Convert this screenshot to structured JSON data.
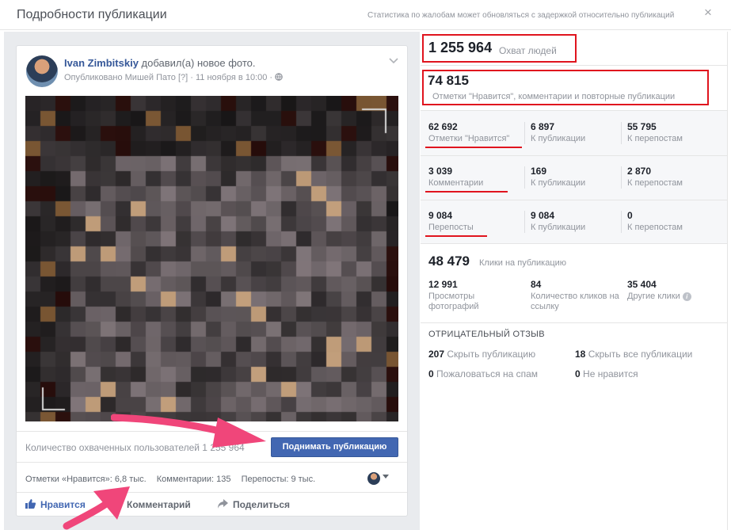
{
  "dialog": {
    "title": "Подробности публикации",
    "note": "Статистика по жалобам может обновляться с задержкой относительно публикаций",
    "close_label": "×"
  },
  "post": {
    "author_name": "Ivan Zimbitskiy",
    "author_action": "добавил(а) новое фото.",
    "published_by": "Опубликовано Мишей Пато",
    "help_marker": "[?]",
    "date": "· 11 ноября в 10:00 ·",
    "reach_text": "Количество охваченных пользователей 1 255 964",
    "boost_button": "Поднимать публикацию",
    "counts": {
      "likes": "Отметки «Нравится»: 6,8 тыс.",
      "comments": "Комментарии: 135",
      "shares": "Перепосты: 9 тыс."
    },
    "actions": {
      "like": "Нравится",
      "comment": "Комментарий",
      "share": "Поделиться"
    }
  },
  "stats": {
    "reach": {
      "value": "1 255 964",
      "label": "Охват людей"
    },
    "engagement": {
      "value": "74 815",
      "label": "Отметки \"Нравится\", комментарии и повторные публикации"
    },
    "likes": [
      {
        "value": "62 692",
        "label": "Отметки \"Нравится\""
      },
      {
        "value": "6 897",
        "label": "К публикации"
      },
      {
        "value": "55 795",
        "label": "К перепостам"
      }
    ],
    "comments": [
      {
        "value": "3 039",
        "label": "Комментарии"
      },
      {
        "value": "169",
        "label": "К публикации"
      },
      {
        "value": "2 870",
        "label": "К перепостам"
      }
    ],
    "shares": [
      {
        "value": "9 084",
        "label": "Перепосты"
      },
      {
        "value": "9 084",
        "label": "К публикации"
      },
      {
        "value": "0",
        "label": "К перепостам"
      }
    ],
    "clicks": {
      "value": "48 479",
      "label": "Клики на публикацию",
      "items": [
        {
          "value": "12 991",
          "label": "Просмотры фотографий"
        },
        {
          "value": "84",
          "label": "Количество кликов на ссылку"
        },
        {
          "value": "35 404",
          "label": "Другие клики"
        }
      ]
    },
    "negative": {
      "title": "ОТРИЦАТЕЛЬНЫЙ ОТЗЫВ",
      "items": [
        {
          "value": "207",
          "label": "Скрыть публикацию"
        },
        {
          "value": "18",
          "label": "Скрыть все публикации"
        },
        {
          "value": "0",
          "label": "Пожаловаться на спам"
        },
        {
          "value": "0",
          "label": "Не нравится"
        }
      ]
    },
    "info_glyph": "i"
  },
  "colors": {
    "accent": "#4267b2",
    "link": "#365899",
    "highlight": "#e0141e",
    "arrow": "#f0467a"
  },
  "icons": [
    "close-icon",
    "chevron-down-icon",
    "globe-icon",
    "like-icon",
    "comment-icon",
    "share-icon",
    "info-icon",
    "caret-down-icon"
  ]
}
